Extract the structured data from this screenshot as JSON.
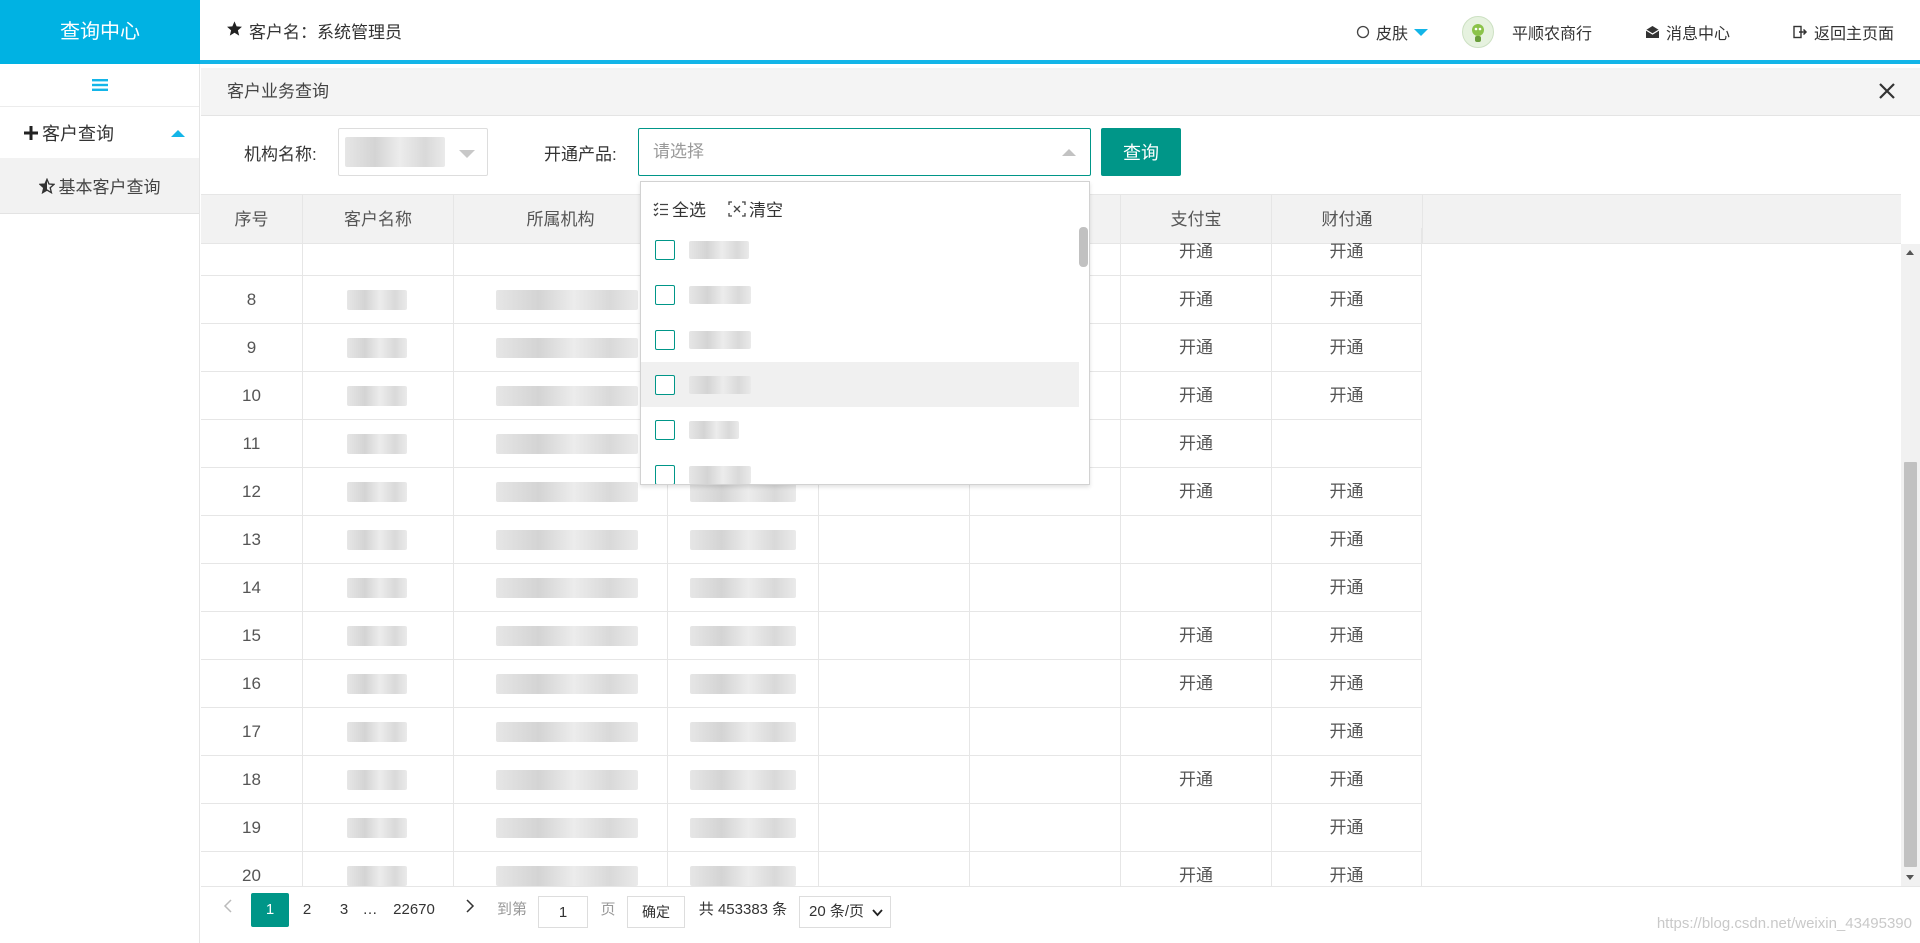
{
  "header": {
    "brand": "查询中心",
    "customer_label": "客户名：系统管理员",
    "skin": "皮肤",
    "bank_name": "平顺农商行",
    "messages": "消息中心",
    "back_home": "返回主页面"
  },
  "sidebar": {
    "group_label": "客户查询",
    "items": [
      {
        "label": "基本客户查询"
      }
    ]
  },
  "panel": {
    "title": "客户业务查询"
  },
  "filter": {
    "org_label": "机构名称:",
    "product_label": "开通产品:",
    "product_placeholder": "请选择",
    "query_button": "查询"
  },
  "dropdown": {
    "select_all": "全选",
    "clear": "清空",
    "option_count": 6
  },
  "table": {
    "columns": [
      "序号",
      "客户名称",
      "所属机构",
      "",
      "",
      "",
      "支付宝",
      "财付通"
    ],
    "rows": [
      {
        "seq": "",
        "alipay": "开通",
        "tenpay": "开通"
      },
      {
        "seq": "8",
        "alipay": "开通",
        "tenpay": "开通"
      },
      {
        "seq": "9",
        "alipay": "开通",
        "tenpay": "开通"
      },
      {
        "seq": "10",
        "alipay": "开通",
        "tenpay": "开通"
      },
      {
        "seq": "11",
        "alipay": "开通",
        "tenpay": ""
      },
      {
        "seq": "12",
        "alipay": "开通",
        "tenpay": "开通"
      },
      {
        "seq": "13",
        "alipay": "",
        "tenpay": "开通"
      },
      {
        "seq": "14",
        "alipay": "",
        "tenpay": "开通"
      },
      {
        "seq": "15",
        "alipay": "开通",
        "tenpay": "开通"
      },
      {
        "seq": "16",
        "alipay": "开通",
        "tenpay": "开通"
      },
      {
        "seq": "17",
        "alipay": "",
        "tenpay": "开通"
      },
      {
        "seq": "18",
        "alipay": "开通",
        "tenpay": "开通"
      },
      {
        "seq": "19",
        "alipay": "",
        "tenpay": "开通"
      },
      {
        "seq": "20",
        "alipay": "开通",
        "tenpay": "开通"
      }
    ]
  },
  "pager": {
    "pages": [
      "1",
      "2",
      "3"
    ],
    "ellipsis": "…",
    "last_page": "22670",
    "goto_label": "到第",
    "goto_value": "1",
    "page_unit": "页",
    "confirm": "确定",
    "total": "共 453383 条",
    "page_size": "20 条/页"
  },
  "watermark": "https://blog.csdn.net/weixin_43495390",
  "colors": {
    "brand": "#00b2e3",
    "accent": "#009688",
    "header_line": "#13b5e8"
  }
}
